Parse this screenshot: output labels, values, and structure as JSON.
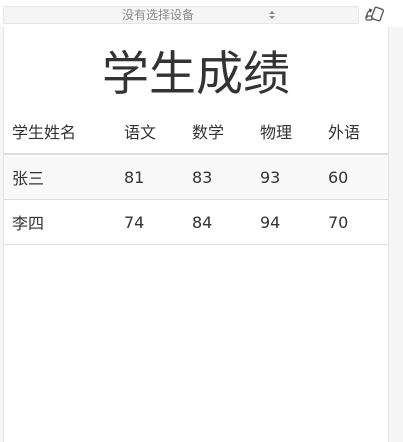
{
  "toolbar": {
    "device_select_value": "没有选择设备",
    "rotate_icon": "rotate-device-icon"
  },
  "page": {
    "title": "学生成绩"
  },
  "table": {
    "headers": [
      "学生姓名",
      "语文",
      "数学",
      "物理",
      "外语"
    ],
    "rows": [
      [
        "张三",
        "81",
        "83",
        "93",
        "60"
      ],
      [
        "李四",
        "74",
        "84",
        "94",
        "70"
      ]
    ]
  },
  "colors": {
    "text": "#333333",
    "border": "#dddddd",
    "stripe": "#f9f9f9",
    "toolbar_text": "#8a8a8a"
  }
}
